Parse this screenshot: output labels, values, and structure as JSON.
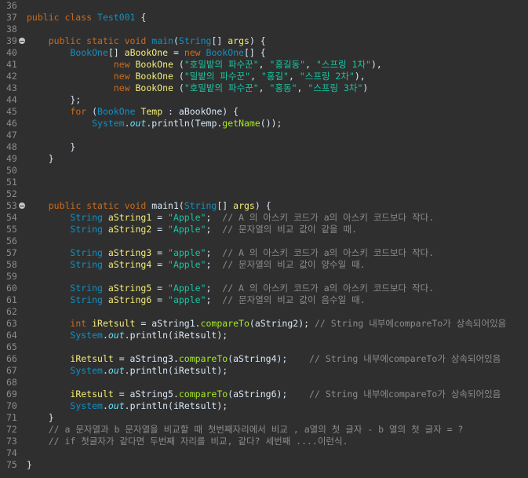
{
  "editor": {
    "lines": [
      {
        "num": "36",
        "tokens": []
      },
      {
        "num": "37",
        "tokens": [
          [
            "kw",
            "public class "
          ],
          [
            "ty",
            "Test001"
          ],
          [
            "plain",
            " {"
          ]
        ]
      },
      {
        "num": "38",
        "tokens": []
      },
      {
        "num": "39",
        "fold": true,
        "tokens": [
          [
            "plain",
            "    "
          ],
          [
            "kw",
            "public static void "
          ],
          [
            "ty",
            "main"
          ],
          [
            "plain",
            "("
          ],
          [
            "ty",
            "String"
          ],
          [
            "plain",
            "[] "
          ],
          [
            "var",
            "args"
          ],
          [
            "plain",
            ") {"
          ]
        ]
      },
      {
        "num": "40",
        "tokens": [
          [
            "plain",
            "        "
          ],
          [
            "ty",
            "BookOne"
          ],
          [
            "plain",
            "[] "
          ],
          [
            "var",
            "aBookOne"
          ],
          [
            "plain",
            " = "
          ],
          [
            "kw",
            "new "
          ],
          [
            "ty",
            "BookOne"
          ],
          [
            "plain",
            "[] {"
          ]
        ]
      },
      {
        "num": "41",
        "tokens": [
          [
            "plain",
            "                "
          ],
          [
            "kw",
            "new "
          ],
          [
            "var",
            "BookOne"
          ],
          [
            "plain",
            " ("
          ],
          [
            "str",
            "\"호밀밭의 파수꾼\""
          ],
          [
            "plain",
            ", "
          ],
          [
            "str",
            "\"홍길동\""
          ],
          [
            "plain",
            ", "
          ],
          [
            "str",
            "\"스프링 1차\""
          ],
          [
            "plain",
            "),"
          ]
        ]
      },
      {
        "num": "42",
        "tokens": [
          [
            "plain",
            "                "
          ],
          [
            "kw",
            "new "
          ],
          [
            "var",
            "BookOne"
          ],
          [
            "plain",
            " ("
          ],
          [
            "str",
            "\"밀밭의 파수꾼\""
          ],
          [
            "plain",
            ", "
          ],
          [
            "str",
            "\"홍길\""
          ],
          [
            "plain",
            ", "
          ],
          [
            "str",
            "\"스프링 2차\""
          ],
          [
            "plain",
            "),"
          ]
        ]
      },
      {
        "num": "43",
        "tokens": [
          [
            "plain",
            "                "
          ],
          [
            "kw",
            "new "
          ],
          [
            "var",
            "BookOne"
          ],
          [
            "plain",
            " ("
          ],
          [
            "str",
            "\"호밀밭의 파수꾼\""
          ],
          [
            "plain",
            ", "
          ],
          [
            "str",
            "\"홍동\""
          ],
          [
            "plain",
            ", "
          ],
          [
            "str",
            "\"스프링 3차\""
          ],
          [
            "plain",
            ")"
          ]
        ]
      },
      {
        "num": "44",
        "tokens": [
          [
            "plain",
            "        };"
          ]
        ]
      },
      {
        "num": "45",
        "tokens": [
          [
            "plain",
            "        "
          ],
          [
            "kw",
            "for "
          ],
          [
            "plain",
            "("
          ],
          [
            "ty",
            "BookOne "
          ],
          [
            "var",
            "Temp"
          ],
          [
            "plain",
            " : aBookOne) {"
          ]
        ]
      },
      {
        "num": "46",
        "tokens": [
          [
            "plain",
            "            "
          ],
          [
            "ty",
            "System"
          ],
          [
            "plain",
            "."
          ],
          [
            "fld",
            "out"
          ],
          [
            "plain",
            ".println(Temp."
          ],
          [
            "mth",
            "getName"
          ],
          [
            "plain",
            "());"
          ]
        ]
      },
      {
        "num": "47",
        "tokens": []
      },
      {
        "num": "48",
        "tokens": [
          [
            "plain",
            "        }"
          ]
        ]
      },
      {
        "num": "49",
        "tokens": [
          [
            "plain",
            "    }"
          ]
        ]
      },
      {
        "num": "50",
        "tokens": []
      },
      {
        "num": "51",
        "tokens": []
      },
      {
        "num": "52",
        "tokens": []
      },
      {
        "num": "53",
        "fold": true,
        "tokens": [
          [
            "plain",
            "    "
          ],
          [
            "kw",
            "public static void "
          ],
          [
            "plain",
            "main1("
          ],
          [
            "ty",
            "String"
          ],
          [
            "plain",
            "[] "
          ],
          [
            "var",
            "args"
          ],
          [
            "plain",
            ") {"
          ]
        ]
      },
      {
        "num": "54",
        "tokens": [
          [
            "plain",
            "        "
          ],
          [
            "ty",
            "String "
          ],
          [
            "var",
            "aString1"
          ],
          [
            "plain",
            " = "
          ],
          [
            "str",
            "\"Apple\""
          ],
          [
            "plain",
            ";  "
          ],
          [
            "cmt",
            "// A 의 아스키 코드가 a의 아스키 코드보다 작다."
          ]
        ]
      },
      {
        "num": "55",
        "tokens": [
          [
            "plain",
            "        "
          ],
          [
            "ty",
            "String "
          ],
          [
            "var",
            "aString2"
          ],
          [
            "plain",
            " = "
          ],
          [
            "str",
            "\"Apple\""
          ],
          [
            "plain",
            ";  "
          ],
          [
            "cmt",
            "// 문자열의 비교 값이 같을 때."
          ]
        ]
      },
      {
        "num": "56",
        "tokens": []
      },
      {
        "num": "57",
        "tokens": [
          [
            "plain",
            "        "
          ],
          [
            "ty",
            "String "
          ],
          [
            "var",
            "aString3"
          ],
          [
            "plain",
            " = "
          ],
          [
            "str",
            "\"apple\""
          ],
          [
            "plain",
            ";  "
          ],
          [
            "cmt",
            "// A 의 아스키 코드가 a의 아스키 코드보다 작다."
          ]
        ]
      },
      {
        "num": "58",
        "tokens": [
          [
            "plain",
            "        "
          ],
          [
            "ty",
            "String "
          ],
          [
            "var",
            "aString4"
          ],
          [
            "plain",
            " = "
          ],
          [
            "str",
            "\"Apple\""
          ],
          [
            "plain",
            ";  "
          ],
          [
            "cmt",
            "// 문자열의 비교 값이 양수일 때."
          ]
        ]
      },
      {
        "num": "59",
        "tokens": []
      },
      {
        "num": "60",
        "tokens": [
          [
            "plain",
            "        "
          ],
          [
            "ty",
            "String "
          ],
          [
            "var",
            "aString5"
          ],
          [
            "plain",
            " = "
          ],
          [
            "str",
            "\"Apple\""
          ],
          [
            "plain",
            ";  "
          ],
          [
            "cmt",
            "// A 의 아스키 코드가 a의 아스키 코드보다 작다."
          ]
        ]
      },
      {
        "num": "61",
        "tokens": [
          [
            "plain",
            "        "
          ],
          [
            "ty",
            "String "
          ],
          [
            "var",
            "aString6"
          ],
          [
            "plain",
            " = "
          ],
          [
            "str",
            "\"apple\""
          ],
          [
            "plain",
            ";  "
          ],
          [
            "cmt",
            "// 문자열의 비교 값이 음수일 때."
          ]
        ]
      },
      {
        "num": "62",
        "tokens": []
      },
      {
        "num": "63",
        "tokens": [
          [
            "plain",
            "        "
          ],
          [
            "kw",
            "int "
          ],
          [
            "var",
            "iRetsult"
          ],
          [
            "plain",
            " = aString1."
          ],
          [
            "mth",
            "compareTo"
          ],
          [
            "plain",
            "(aString2); "
          ],
          [
            "cmt",
            "// String 내부에compareTo가 상속되어있음"
          ]
        ]
      },
      {
        "num": "64",
        "tokens": [
          [
            "plain",
            "        "
          ],
          [
            "ty",
            "System"
          ],
          [
            "plain",
            "."
          ],
          [
            "fld",
            "out"
          ],
          [
            "plain",
            ".println(iRetsult);"
          ]
        ]
      },
      {
        "num": "65",
        "tokens": []
      },
      {
        "num": "66",
        "tokens": [
          [
            "plain",
            "        "
          ],
          [
            "var",
            "iRetsult"
          ],
          [
            "plain",
            " = aString3."
          ],
          [
            "mth",
            "compareTo"
          ],
          [
            "plain",
            "(aString4);    "
          ],
          [
            "cmt",
            "// String 내부에compareTo가 상속되어있음"
          ]
        ]
      },
      {
        "num": "67",
        "tokens": [
          [
            "plain",
            "        "
          ],
          [
            "ty",
            "System"
          ],
          [
            "plain",
            "."
          ],
          [
            "fld",
            "out"
          ],
          [
            "plain",
            ".println(iRetsult);"
          ]
        ]
      },
      {
        "num": "68",
        "tokens": []
      },
      {
        "num": "69",
        "tokens": [
          [
            "plain",
            "        "
          ],
          [
            "var",
            "iRetsult"
          ],
          [
            "plain",
            " = aString5."
          ],
          [
            "mth",
            "compareTo"
          ],
          [
            "plain",
            "(aString6);    "
          ],
          [
            "cmt",
            "// String 내부에compareTo가 상속되어있음"
          ]
        ]
      },
      {
        "num": "70",
        "tokens": [
          [
            "plain",
            "        "
          ],
          [
            "ty",
            "System"
          ],
          [
            "plain",
            "."
          ],
          [
            "fld",
            "out"
          ],
          [
            "plain",
            ".println(iRetsult);"
          ]
        ]
      },
      {
        "num": "71",
        "tokens": [
          [
            "plain",
            "    }"
          ]
        ]
      },
      {
        "num": "72",
        "tokens": [
          [
            "plain",
            "    "
          ],
          [
            "cmt",
            "// a 문자열과 b 문자열을 비교할 때 첫번째자리에서 비교 , a열의 첫 글자 - b 열의 첫 글자 = ?"
          ]
        ]
      },
      {
        "num": "73",
        "tokens": [
          [
            "plain",
            "    "
          ],
          [
            "cmt",
            "// if 첫글자가 같다면 두번째 자리를 비교, 같다? 세번째 ....이런식."
          ]
        ]
      },
      {
        "num": "74",
        "tokens": []
      },
      {
        "num": "75",
        "tokens": [
          [
            "plain",
            "}"
          ]
        ]
      }
    ]
  }
}
